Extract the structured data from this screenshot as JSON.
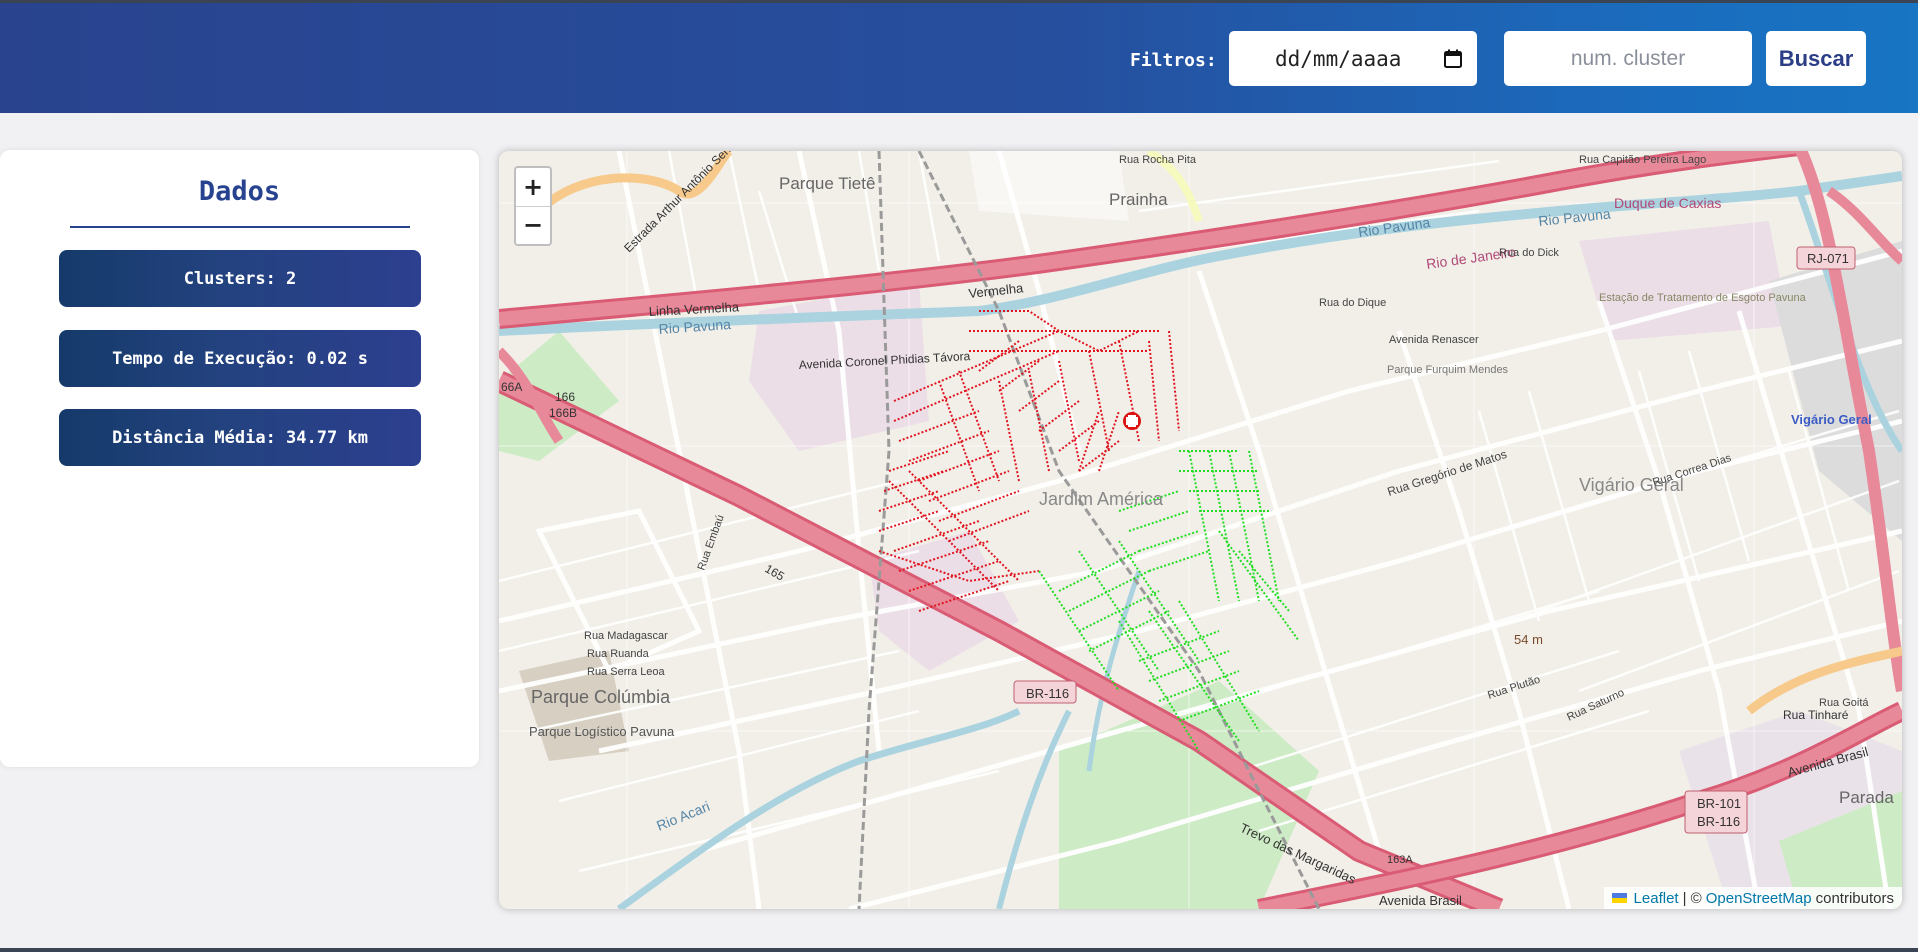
{
  "header": {
    "filters_label": "Filtros:",
    "date_placeholder": "dd/mm/aaaa",
    "cluster_placeholder": "num. cluster",
    "search_button": "Buscar"
  },
  "panel": {
    "title": "Dados",
    "stats": [
      "Clusters: 2",
      "Tempo de Execução: 0.02 s",
      "Distância Média: 34.77 km"
    ]
  },
  "map": {
    "zoom_in": "+",
    "zoom_out": "−",
    "attribution": {
      "leaflet": "Leaflet",
      "separator": "| ©",
      "osm": "OpenStreetMap",
      "suffix": "contributors"
    },
    "labels": {
      "parque_tiete": "Parque Tietê",
      "prainha": "Prainha",
      "rio_pavuna_1": "Rio Pavuna",
      "rio_pavuna_2": "Rio Pavuna",
      "rio_pavuna_3": "Rio Pavuna",
      "rio_de_janeiro": "Rio de Janeiro",
      "linha_vermelha": "Linha Vermelha",
      "vermelha": "Vermelha",
      "av_phidias": "Avenida Coronel Phidias Távora",
      "jardim_america": "Jardim América",
      "vigario_geral": "Vigário Geral",
      "vigario_geral_station": "Vigário Geral",
      "parque_columbia": "Parque Colúmbia",
      "parque_logistico": "Parque Logístico Pavuna",
      "parque_furquim": "Parque Furquim Mendes",
      "estacao": "Estação de Tratamento de Esgoto Pavuna",
      "duque_de_caxias": "Duque de Caxias",
      "br116": "BR-116",
      "br101": "BR-101",
      "br116b": "BR-116",
      "rj071": "RJ-071",
      "avenida_brasil": "Avenida Brasil",
      "avenida_brasil_2": "Avenida Brasil",
      "trevo": "Trevo das Margaridas",
      "rio_acari": "Rio Acari",
      "parada": "Parada",
      "rua_rocha_pita": "Rua Rocha Pita",
      "rua_capitao": "Rua Capitão Pereira Lago",
      "rua_do_dick": "Rua do Dick",
      "av_renascer": "Avenida Renascer",
      "rua_do_dique": "Rua do Dique",
      "rua_gregorio": "Rua Gregório de Matos",
      "rua_correa_dias": "Rua Correa Dias",
      "rua_embau": "Rua Embaú",
      "rua_madagascar": "Rua Madagascar",
      "rua_ruanda": "Rua Ruanda",
      "rua_serra_leoa": "Rua Serra Leoa",
      "rua_plutao": "Rua Plutão",
      "rua_saturno": "Rua Saturno",
      "rua_tinhare": "Rua Tinharé",
      "rua_goita": "Rua Goitá",
      "elev_54": "54 m",
      "est_arthur": "Estrada Arthur Antônio Sendas",
      "n165": "165",
      "n166": "166",
      "n166b": "166B",
      "n66a": "66A",
      "n163a": "163A"
    }
  },
  "colors": {
    "header_start": "#29438e",
    "header_end": "#1775c3",
    "stat_bg": "#23427f",
    "cluster1": "#e0141e",
    "cluster2": "#22dd22",
    "motorway": "#e8899a",
    "river": "#aad3df"
  }
}
